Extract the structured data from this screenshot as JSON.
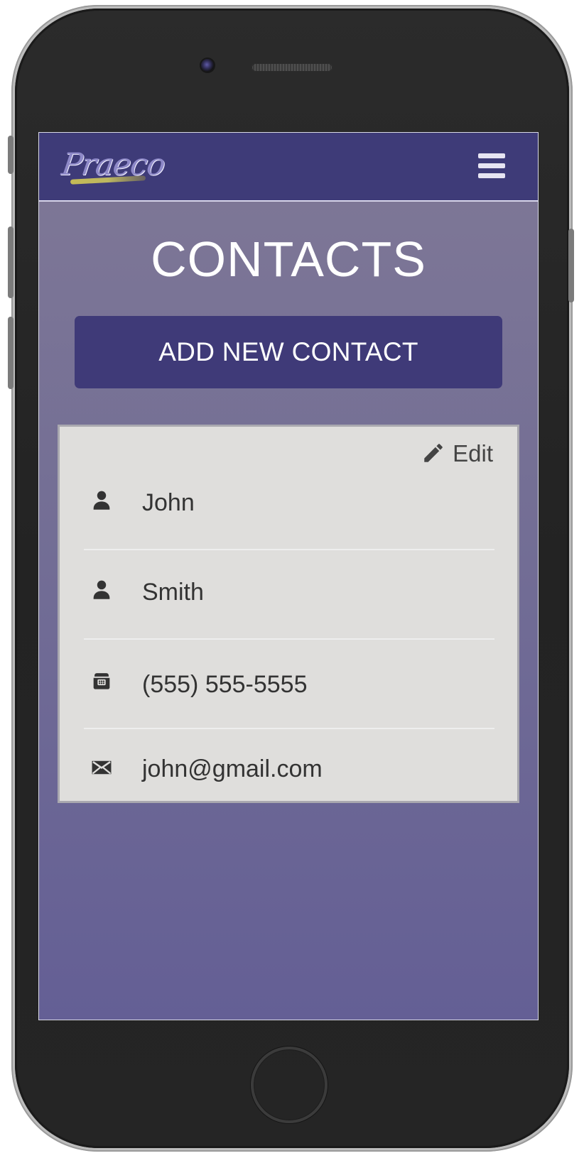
{
  "app": {
    "logo_text": "Praeco",
    "title": "CONTACTS",
    "add_button_label": "ADD NEW CONTACT",
    "edit_label": "Edit"
  },
  "contact": {
    "first_name": "John",
    "last_name": "Smith",
    "phone": "(555) 555-5555",
    "email": "john@gmail.com"
  },
  "icons": {
    "menu": "menu-icon",
    "edit": "pencil-icon",
    "person": "user-icon",
    "phone": "phone-icon",
    "email": "envelope-icon"
  },
  "colors": {
    "navbar": "#3e3b78",
    "button": "#3f3a78",
    "background_top": "#7f7896",
    "background_bottom": "#645f95",
    "card": "#dfdedc",
    "text_dark": "#333333",
    "text_light": "#ffffff"
  }
}
